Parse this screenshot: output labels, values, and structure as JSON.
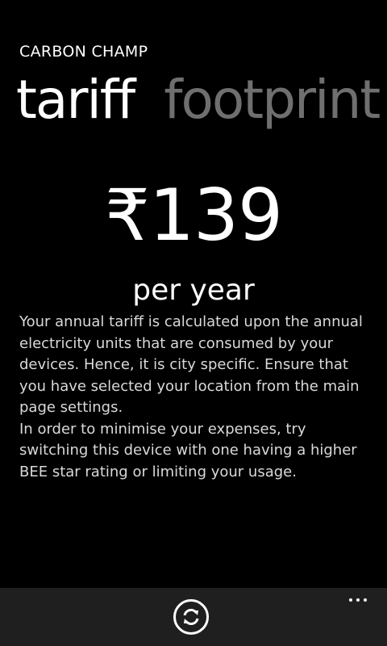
{
  "app": {
    "title": "CARBON CHAMP"
  },
  "pivot": {
    "items": [
      {
        "label": "tariff",
        "state": "active"
      },
      {
        "label": "footprint",
        "state": "inactive"
      }
    ]
  },
  "tariff": {
    "amount": "₹139",
    "period": "per year",
    "description": [
      "Your annual tariff is calculated upon the annual electricity units that are consumed by your devices. Hence, it is city specific. Ensure that you have selected your location from the main page settings.",
      "In order to minimise your expenses, try switching this device with one having a higher BEE star rating or limiting your usage."
    ]
  },
  "app_bar": {
    "buttons": [
      {
        "icon": "refresh-icon"
      }
    ],
    "more_icon": "ellipsis-icon"
  },
  "colors": {
    "background": "#000000",
    "text": "#ffffff",
    "inactive_pivot": "#6f6f6f",
    "body_text": "#d9d9d9",
    "app_bar": "#1f1f1f"
  }
}
